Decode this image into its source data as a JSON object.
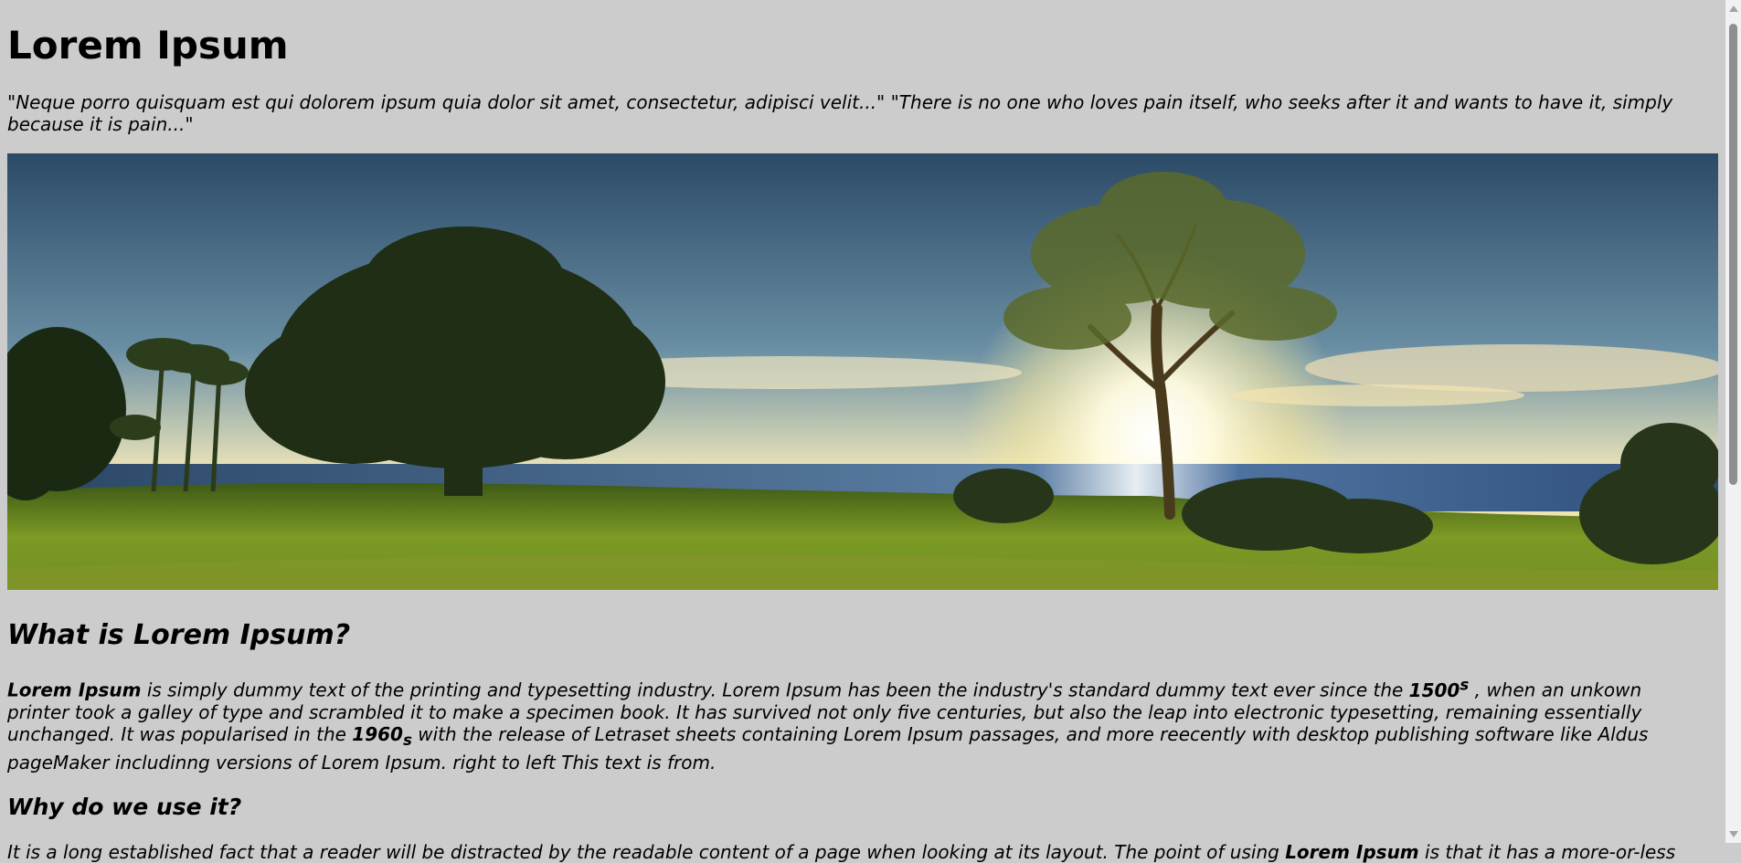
{
  "header": {
    "title": "Lorem Ipsum",
    "quote": "\"Neque porro quisquam est qui dolorem ipsum quia dolor sit amet, consectetur, adipisci velit...\" \"There is no one who loves pain itself, who seeks after it and wants to have it, simply because it is pain...\""
  },
  "hero": {
    "description": "panoramic landscape-photo",
    "colors": {
      "sky_top": "#2b4a67",
      "sun": "#fffbe0",
      "sea": "#2f4d78",
      "grass": "#6f8f22"
    }
  },
  "section1": {
    "heading": "What is Lorem Ipsum?",
    "lead_bold": "Lorem Ipsum",
    "text_a": " is simply dummy text of the printing and typesetting industry. Lorem Ipsum has been the industry's standard dummy text ever since the ",
    "year1": "1500",
    "year1_sup": "s",
    "text_b": " , when an unkown printer took a galley of type and scrambled it to make a specimen book. It has survived not only five centuries, but also the leap into electronic typesetting, remaining essentially unchanged. It was popularised in the ",
    "year2": "1960",
    "year2_sub": "s",
    "text_c": " with the release of Letraset sheets containing Lorem Ipsum passages, and more reecently with desktop publishing software like Aldus pageMaker includinng versions of Lorem Ipsum. right to left This text is from."
  },
  "section2": {
    "heading": "Why do we use it?",
    "text_start": "It is a long established fact that a reader will be distracted by the readable content of a page when looking at its layout. The point of using ",
    "text_bold": "Lorem Ipsum",
    "text_end": " is that it has a more-or-less"
  }
}
